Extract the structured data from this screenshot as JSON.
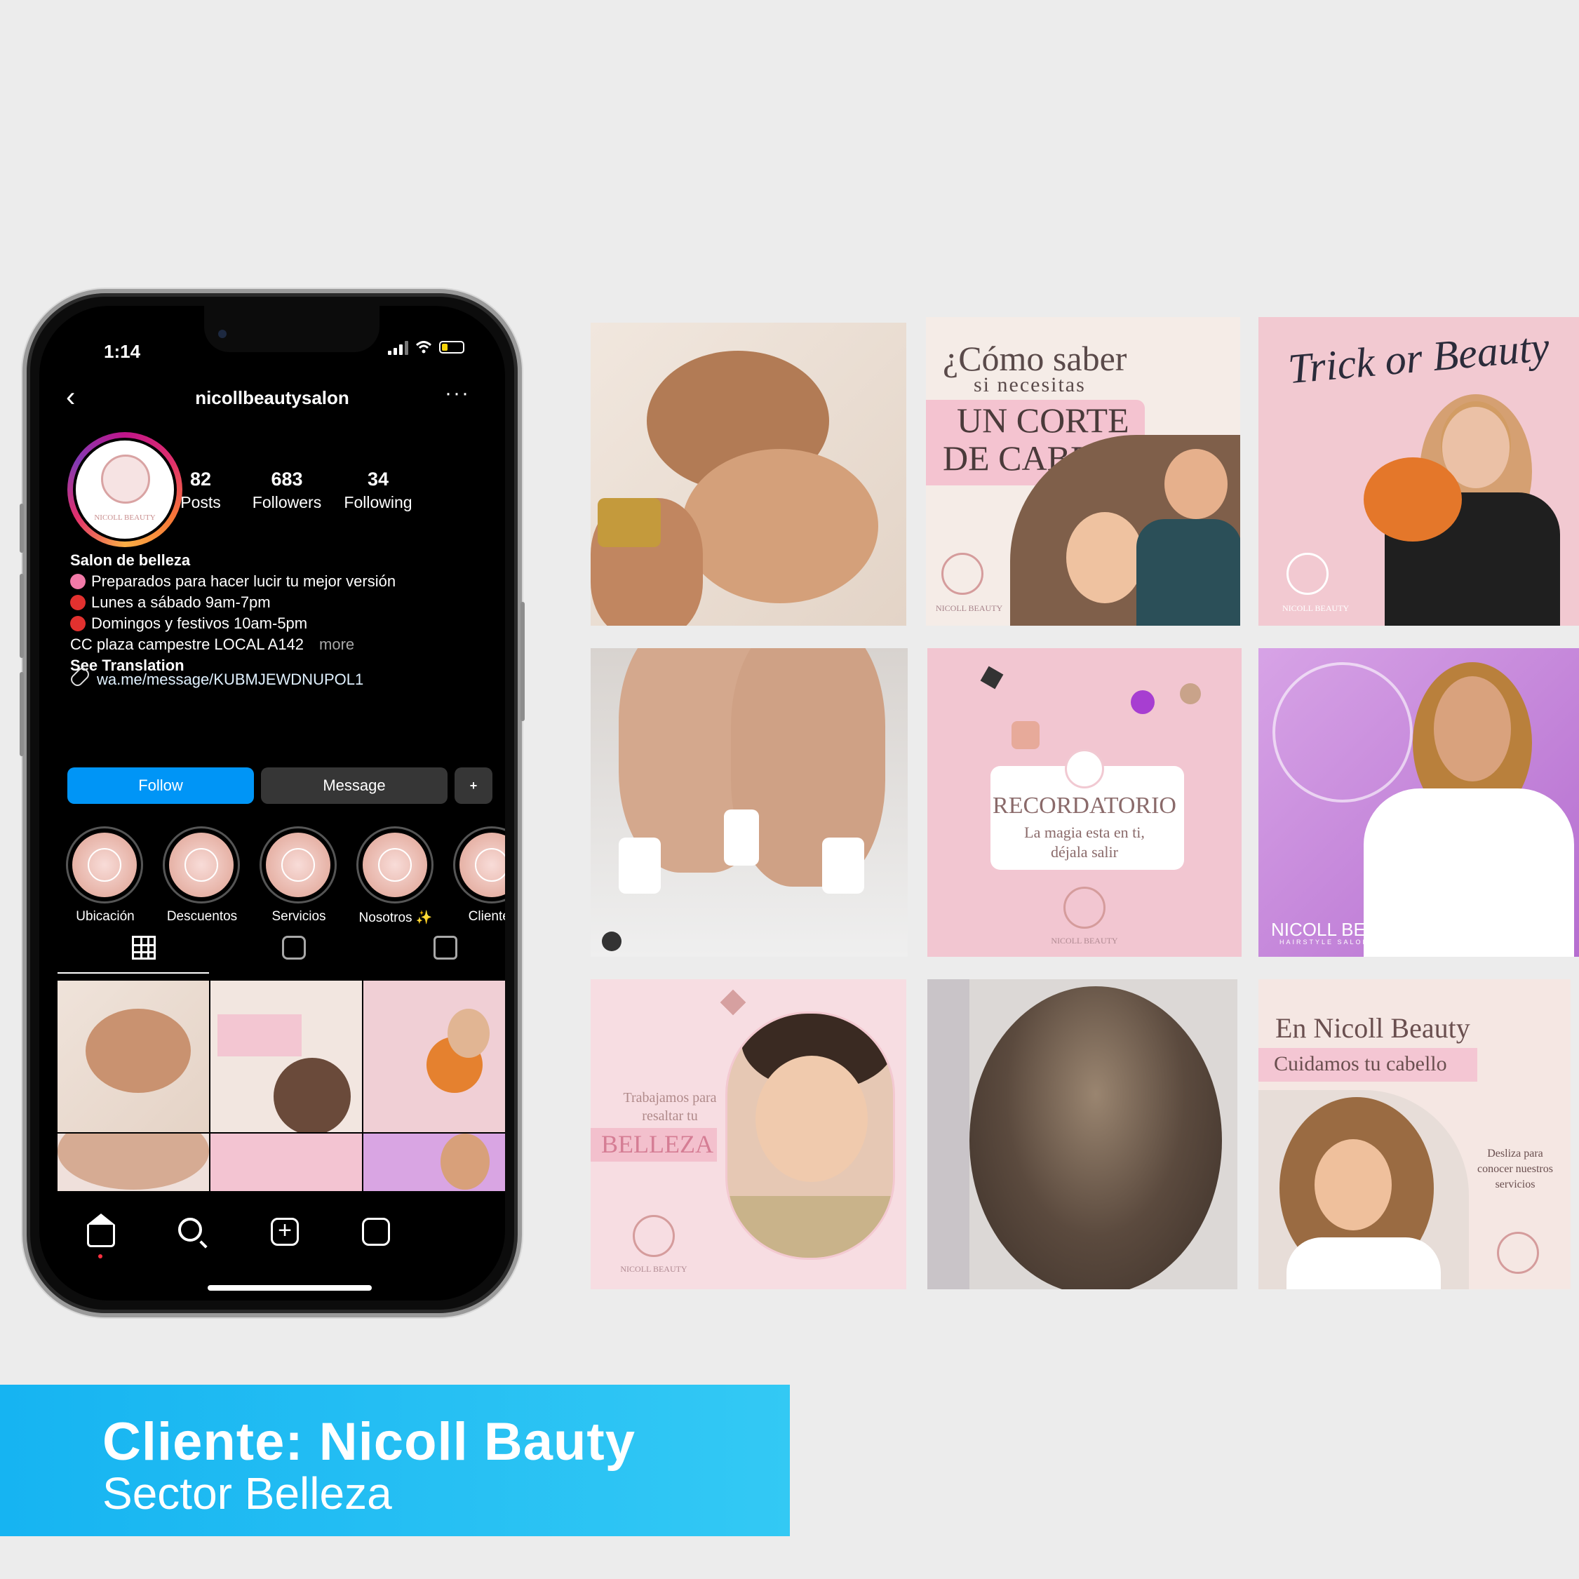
{
  "status": {
    "time": "1:14"
  },
  "profile": {
    "username": "nicollbeautysalon",
    "avatar_text": "NICOLL BEAUTY",
    "stats": [
      {
        "value": "82",
        "label": "Posts"
      },
      {
        "value": "683",
        "label": "Followers"
      },
      {
        "value": "34",
        "label": "Following"
      }
    ],
    "bio": {
      "name": "Salon de belleza",
      "lines": [
        "Preparados para hacer lucir tu mejor versión",
        "Lunes a sábado 9am-7pm",
        "Domingos y festivos 10am-5pm"
      ],
      "address": "CC plaza campestre LOCAL A142",
      "more": "more",
      "see_translation": "See Translation",
      "link": "wa.me/message/KUBMJEWDNUPOL1"
    },
    "buttons": {
      "follow": "Follow",
      "message": "Message",
      "add_person": "+"
    },
    "highlights": [
      "Ubicación",
      "Descuentos",
      "Servicios",
      "Nosotros ✨",
      "Clientes"
    ]
  },
  "posts": {
    "p2": {
      "line1": "¿Cómo saber",
      "line2": "si necesitas",
      "line3": "UN CORTE",
      "line4": "DE CABELLO?",
      "brand": "NICOLL BEAUTY"
    },
    "p3": {
      "title": "Trick or Beauty",
      "brand": "NICOLL BEAUTY"
    },
    "p5": {
      "title": "RECORDATORIO",
      "line1": "La magia esta en ti,",
      "line2": "déjala salir",
      "brand": "NICOLL BEAUTY"
    },
    "p6": {
      "brand": "NICOLL BEAUTY",
      "tagline": "HAIRSTYLE SALON"
    },
    "p7": {
      "line1": "Trabajamos para",
      "line2": "resaltar tu",
      "line3": "BELLEZA",
      "brand": "NICOLL BEAUTY"
    },
    "p9": {
      "line1": "En Nicoll Beauty",
      "line2": "Cuidamos tu cabello",
      "line3": "Desliza para",
      "line4": "conocer nuestros",
      "line5": "servicios"
    }
  },
  "banner": {
    "title": "Cliente: Nicoll Bauty",
    "subtitle": "Sector Belleza"
  },
  "colors": {
    "follow_blue": "#0095f6",
    "banner_blue": "#16b4f2",
    "pink": "#f4cfd6"
  }
}
